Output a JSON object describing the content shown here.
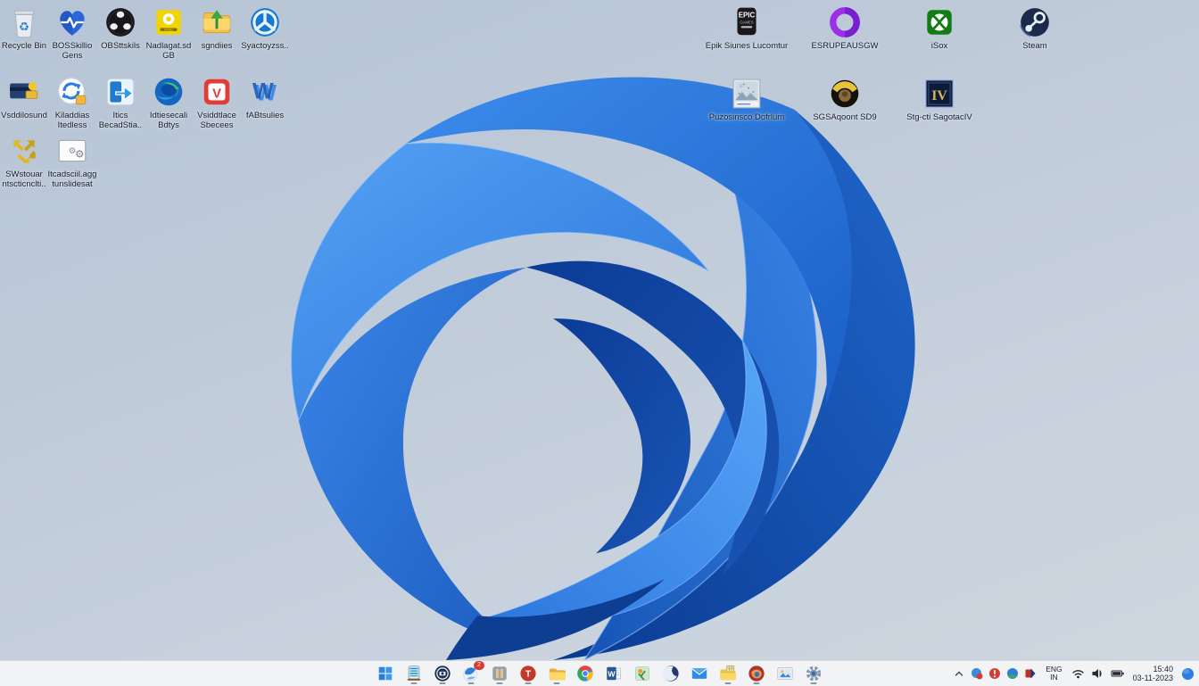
{
  "colors": {
    "taskbar_bg": "#f2f3f5",
    "accent_blue": "#2f7ce0",
    "bloom_primary": "#1663cf",
    "desktop_bg": "#c2cdda"
  },
  "desktop": {
    "left_icons": [
      {
        "label": "Recycle Bin",
        "icon": "recycle-bin-icon",
        "shortcut": false
      },
      {
        "label": "BOSSkillio Gens",
        "icon": "health-heart-icon",
        "shortcut": true
      },
      {
        "label": "OBSttskils",
        "icon": "obs-studio-icon",
        "shortcut": true
      },
      {
        "label": "Nadlagat.sd GB",
        "icon": "yellow-id-card-icon",
        "shortcut": true
      },
      {
        "label": "sgndiies",
        "icon": "folder-tree-icon",
        "shortcut": false
      },
      {
        "label": "Syactoyzss..",
        "icon": "nav-wheel-icon",
        "shortcut": false
      },
      {
        "label": "Vsddilosund",
        "icon": "wallet-icon",
        "shortcut": true
      },
      {
        "label": "Kiladdias Itedless",
        "icon": "sync-update-icon",
        "shortcut": true
      },
      {
        "label": "Itics BecadStia..",
        "icon": "backup-arrow-icon",
        "shortcut": true
      },
      {
        "label": "Idtiesecali Bdtys",
        "icon": "edge-browser-icon",
        "shortcut": true
      },
      {
        "label": "Vsiddtlace Sbecees",
        "icon": "vivaldi-icon",
        "shortcut": true
      },
      {
        "label": "fABtsulies",
        "icon": "blue-w-icon",
        "shortcut": true
      },
      {
        "label": "SWstouar ntscticnclti..",
        "icon": "yellow-arrows-icon",
        "shortcut": true
      },
      {
        "label": "Itcadsciil.agg tunslidesat",
        "icon": "installer-box-icon",
        "shortcut": false
      }
    ],
    "right_icons_row1": [
      {
        "label": "Epik Siunes Lucomtur",
        "icon": "epic-games-icon",
        "shortcut": true
      },
      {
        "label": "ESRUPEAUSGW",
        "icon": "purple-ring-icon",
        "shortcut": true
      },
      {
        "label": "iSox",
        "icon": "xbox-icon",
        "shortcut": true
      },
      {
        "label": "Steam",
        "icon": "steam-icon",
        "shortcut": true
      }
    ],
    "right_icons_row2": [
      {
        "label": "Puzosinsco Dofrlum",
        "icon": "screenshot-thumb-icon",
        "shortcut": true
      },
      {
        "label": "SGSAqoont SD9",
        "icon": "game-avatar-icon",
        "shortcut": true
      },
      {
        "label": "Stg-cti SagotacIV",
        "icon": "civ-four-icon",
        "shortcut": true
      }
    ]
  },
  "taskbar": {
    "items": [
      {
        "name": "start-button",
        "icon": "windows-start-icon",
        "running": false
      },
      {
        "name": "widgets-app",
        "icon": "abacus-widget-icon",
        "running": true
      },
      {
        "name": "camera-app",
        "icon": "camera-circle-icon",
        "running": true
      },
      {
        "name": "browser-sphere-app",
        "icon": "blue-sphere-icon",
        "running": true,
        "badge": "2"
      },
      {
        "name": "reader-app",
        "icon": "gray-book-icon",
        "running": true
      },
      {
        "name": "red-t-app",
        "icon": "red-t-icon",
        "running": true
      },
      {
        "name": "file-explorer",
        "icon": "folder-explorer-icon",
        "running": true
      },
      {
        "name": "chrome-browser",
        "icon": "chrome-icon",
        "running": false
      },
      {
        "name": "word-app",
        "icon": "word-icon",
        "running": false
      },
      {
        "name": "green-game-app",
        "icon": "green-figure-icon",
        "running": false
      },
      {
        "name": "moon-browser-app",
        "icon": "moon-swirl-icon",
        "running": false
      },
      {
        "name": "mail-app",
        "icon": "mail-envelope-icon",
        "running": false
      },
      {
        "name": "notes-folder-app",
        "icon": "folder-notes-icon",
        "running": true
      },
      {
        "name": "fire-browser-app",
        "icon": "fire-circle-icon",
        "running": true
      },
      {
        "name": "photos-app",
        "icon": "photos-icon",
        "running": false
      },
      {
        "name": "settings-app",
        "icon": "settings-gear-icon",
        "running": true
      }
    ]
  },
  "tray": {
    "hidden_icons": [
      {
        "name": "tray-app-blue-alert",
        "icon": "tray-blue-red-icon"
      },
      {
        "name": "tray-app-warning",
        "icon": "tray-red-excl-icon"
      },
      {
        "name": "tray-app-sync",
        "icon": "tray-blue-green-icon"
      },
      {
        "name": "tray-app-puzzle",
        "icon": "tray-red-puzzle-icon"
      }
    ],
    "language_line1": "ENG",
    "language_line2": "IN",
    "time": "15:40",
    "date": "03-11-2023"
  }
}
